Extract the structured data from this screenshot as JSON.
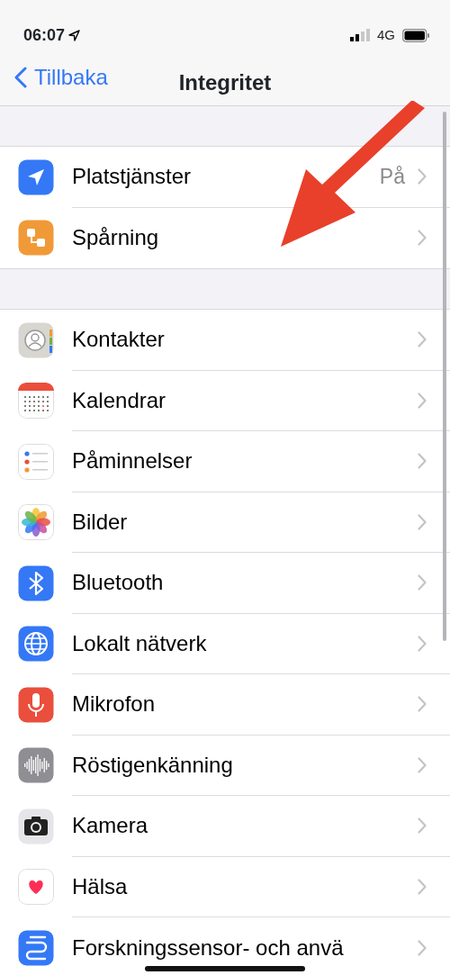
{
  "status_bar": {
    "time": "06:07",
    "network": "4G"
  },
  "nav": {
    "back": "Tillbaka",
    "title": "Integritet"
  },
  "sections": [
    {
      "rows": [
        {
          "label": "Platstjänster",
          "value": "På",
          "kind": "location",
          "color": "#3478f6"
        },
        {
          "label": "Spårning",
          "kind": "tracking",
          "color": "#f09a37"
        }
      ]
    },
    {
      "rows": [
        {
          "label": "Kontakter",
          "kind": "contacts",
          "color": "#d8d6d0"
        },
        {
          "label": "Kalendrar",
          "kind": "calendar"
        },
        {
          "label": "Påminnelser",
          "kind": "reminders"
        },
        {
          "label": "Bilder",
          "kind": "photos"
        },
        {
          "label": "Bluetooth",
          "kind": "bluetooth",
          "color": "#3478f6"
        },
        {
          "label": "Lokalt nätverk",
          "kind": "globe",
          "color": "#3478f6"
        },
        {
          "label": "Mikrofon",
          "kind": "mic",
          "color": "#ea4e3d"
        },
        {
          "label": "Röstigenkänning",
          "kind": "wave",
          "color": "#8e8e93"
        },
        {
          "label": "Kamera",
          "kind": "camera",
          "color": "#e5e5ea"
        },
        {
          "label": "Hälsa",
          "kind": "heart"
        },
        {
          "label": "Forskningssensor- och anvä",
          "kind": "research",
          "color": "#3478f6"
        }
      ]
    }
  ]
}
